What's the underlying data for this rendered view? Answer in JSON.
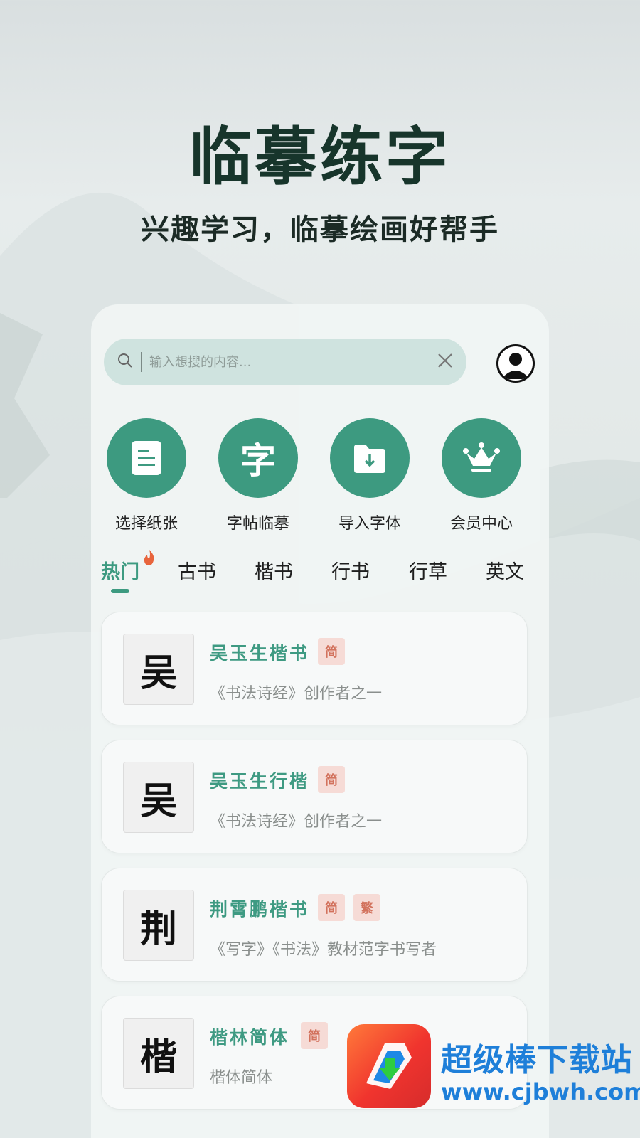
{
  "hero": {
    "title": "临摹练字",
    "subtitle": "兴趣学习，临摹绘画好帮手"
  },
  "search": {
    "placeholder": "输入想搜的内容..."
  },
  "features": [
    {
      "label": "选择纸张",
      "icon": "document-icon"
    },
    {
      "label": "字帖临摹",
      "icon": "zi-character-icon",
      "glyph": "字"
    },
    {
      "label": "导入字体",
      "icon": "folder-import-icon"
    },
    {
      "label": "会员中心",
      "icon": "crown-icon"
    }
  ],
  "tabs": [
    {
      "label": "热门",
      "active": true
    },
    {
      "label": "古书"
    },
    {
      "label": "楷书"
    },
    {
      "label": "行书"
    },
    {
      "label": "行草"
    },
    {
      "label": "英文"
    }
  ],
  "items": [
    {
      "glyph": "吴",
      "title": "吴玉生楷书",
      "badges": [
        "简"
      ],
      "desc": "《书法诗经》创作者之一"
    },
    {
      "glyph": "吴",
      "title": "吴玉生行楷",
      "badges": [
        "简"
      ],
      "desc": "《书法诗经》创作者之一"
    },
    {
      "glyph": "荆",
      "title": "荆霄鹏楷书",
      "badges": [
        "简",
        "繁"
      ],
      "desc": "《写字》《书法》教材范字书写者"
    },
    {
      "glyph": "楷",
      "title": "楷林简体",
      "badges": [
        "简"
      ],
      "desc": "楷体简体"
    }
  ],
  "watermark": {
    "name": "超级棒下载站",
    "url": "www.cjbwh.com"
  },
  "colors": {
    "accent": "#3d9a80",
    "badge_bg": "#f6dbd6",
    "badge_text": "#d2725d",
    "hot_flame": "#e8643c"
  }
}
